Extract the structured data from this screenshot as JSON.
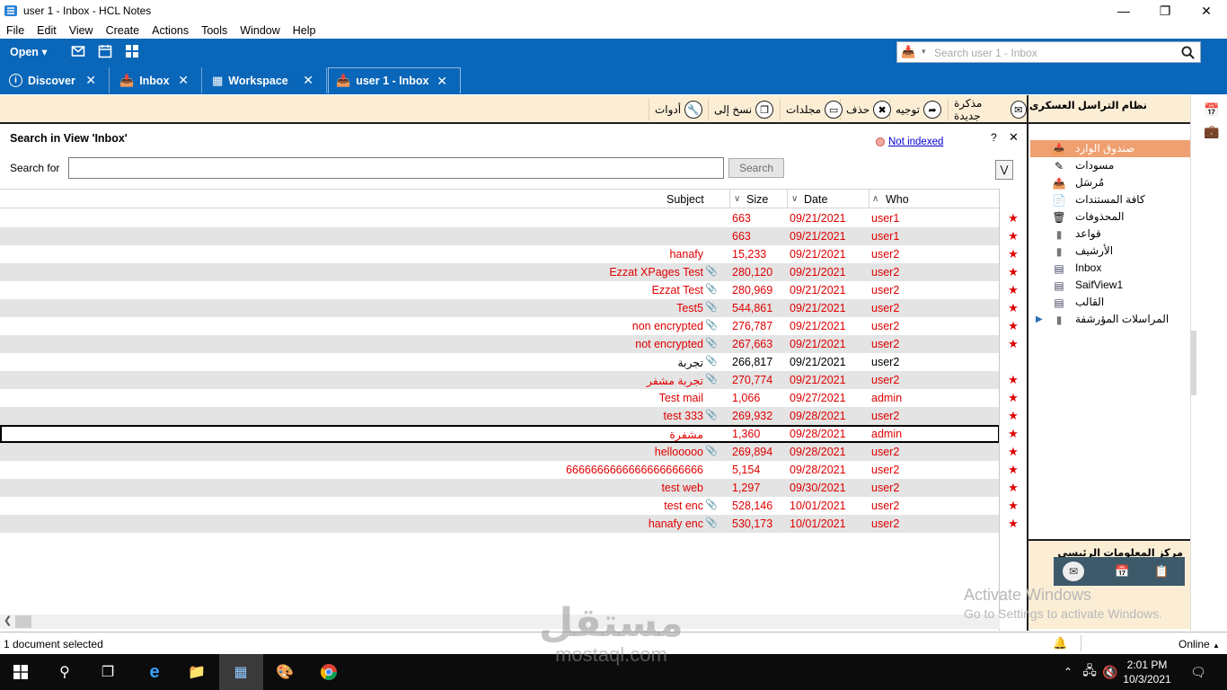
{
  "window": {
    "title": "user 1 - Inbox - HCL Notes"
  },
  "menu": [
    "File",
    "Edit",
    "View",
    "Create",
    "Actions",
    "Tools",
    "Window",
    "Help"
  ],
  "toolbar": {
    "open_label": "Open",
    "search_placeholder": "Search user 1 - Inbox"
  },
  "tabs": [
    {
      "label": "Discover"
    },
    {
      "label": "Inbox"
    },
    {
      "label": "Workspace"
    },
    {
      "label": "user 1 - Inbox"
    }
  ],
  "actions": [
    "مذكرة جديدة",
    "توجيه",
    "حذف",
    "مجلدات",
    "نسخ إلى",
    "أدوات"
  ],
  "search_panel": {
    "title": "Search in View 'Inbox'",
    "label": "Search for",
    "button": "Search",
    "not_indexed": "Not indexed",
    "help": "?"
  },
  "columns": {
    "subject": "Subject",
    "size": "Size",
    "date": "Date",
    "who": "Who"
  },
  "rows": [
    {
      "subject": "",
      "size": "663",
      "date": "09/21/2021",
      "who": "user1"
    },
    {
      "subject": "",
      "size": "663",
      "date": "09/21/2021",
      "who": "user1"
    },
    {
      "subject": "hanafy",
      "size": "15,233",
      "date": "09/21/2021",
      "who": "user2"
    },
    {
      "subject": "Ezzat XPages Test",
      "size": "280,120",
      "date": "09/21/2021",
      "who": "user2"
    },
    {
      "subject": "Ezzat Test",
      "size": "280,969",
      "date": "09/21/2021",
      "who": "user2"
    },
    {
      "subject": "Test5",
      "size": "544,861",
      "date": "09/21/2021",
      "who": "user2"
    },
    {
      "subject": "non encrypted",
      "size": "276,787",
      "date": "09/21/2021",
      "who": "user2"
    },
    {
      "subject": "not encrypted",
      "size": "267,663",
      "date": "09/21/2021",
      "who": "user2"
    },
    {
      "subject": "تجربة",
      "size": "266,817",
      "date": "09/21/2021",
      "who": "user2"
    },
    {
      "subject": "تجربة مشفر",
      "size": "270,774",
      "date": "09/21/2021",
      "who": "user2"
    },
    {
      "subject": "Test mail",
      "size": "1,066",
      "date": "09/27/2021",
      "who": "admin"
    },
    {
      "subject": "test 333",
      "size": "269,932",
      "date": "09/28/2021",
      "who": "user2"
    },
    {
      "subject": "مشفرة",
      "size": "1,360",
      "date": "09/28/2021",
      "who": "admin"
    },
    {
      "subject": "hellooooo",
      "size": "269,894",
      "date": "09/28/2021",
      "who": "user2"
    },
    {
      "subject": "6666666666666666666666",
      "size": "5,154",
      "date": "09/28/2021",
      "who": "user2"
    },
    {
      "subject": "test web",
      "size": "1,297",
      "date": "09/30/2021",
      "who": "user2"
    },
    {
      "subject": "test enc",
      "size": "528,146",
      "date": "10/01/2021",
      "who": "user2"
    },
    {
      "subject": "hanafy enc",
      "size": "530,173",
      "date": "10/01/2021",
      "who": "user2"
    }
  ],
  "navigator": {
    "header": "نظام التراسل العسكرى",
    "items": [
      "صندوق الوارد",
      "مسودات",
      "مُرسَل",
      "كافة المستندات",
      "المحذوفات",
      "قواعد",
      "الأرشيف",
      "Inbox",
      "SaifView1",
      "القالب",
      "المراسلات المؤرشفة"
    ],
    "footer_title": "مركز المعلومات الرئيسى"
  },
  "status": {
    "text": "1 document selected",
    "online": "Online"
  },
  "taskbar": {
    "time": "2:01 PM",
    "date": "10/3/2021"
  },
  "watermark": {
    "activate_title": "Activate Windows",
    "activate_sub": "Go to Settings to activate Windows.",
    "brand_ar": "مستقل",
    "brand_en": "mostaql.com"
  }
}
